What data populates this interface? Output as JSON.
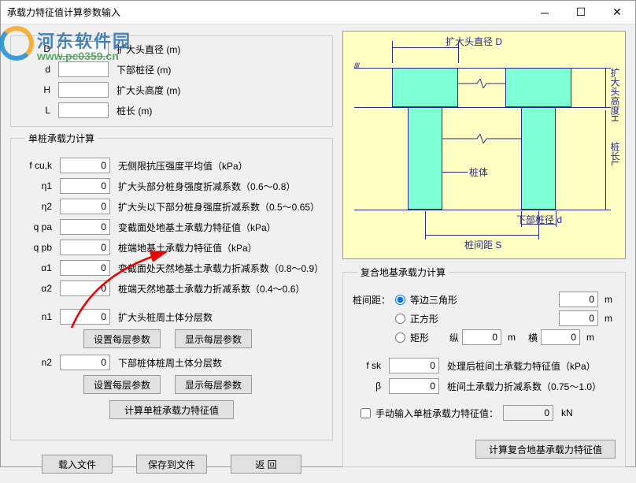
{
  "window": {
    "title": "承载力特征值计算参数输入"
  },
  "watermark": {
    "logo_text": "河东软件园",
    "url_text": "www.pc0359.cn"
  },
  "geom": {
    "D": {
      "sym": "D",
      "val": "",
      "desc": "扩大头直径  (m)"
    },
    "d": {
      "sym": "d",
      "val": "",
      "desc": "下部桩径  (m)"
    },
    "H": {
      "sym": "H",
      "val": "",
      "desc": "扩大头高度  (m)"
    },
    "L": {
      "sym": "L",
      "val": "",
      "desc": "桩长  (m)"
    }
  },
  "sec1": {
    "title": "单桩承载力计算",
    "fcu": {
      "sym": "f cu,k",
      "val": "0",
      "desc": "无侧限抗压强度平均值（kPa）"
    },
    "eta1": {
      "sym": "η1",
      "val": "0",
      "desc": "扩大头部分桩身强度折减系数（0.6～0.8）"
    },
    "eta2": {
      "sym": "η2",
      "val": "0",
      "desc": "扩大头以下部分桩身强度折减系数（0.5～0.65）"
    },
    "qpa": {
      "sym": "q pa",
      "val": "0",
      "desc": "变截面处地基土承载力特征值（kPa）"
    },
    "qpb": {
      "sym": "q pb",
      "val": "0",
      "desc": "桩端地基土承载力特征值（kPa）"
    },
    "a1": {
      "sym": "α1",
      "val": "0",
      "desc": "变截面处天然地基土承载力折减系数（0.8～0.9）"
    },
    "a2": {
      "sym": "α2",
      "val": "0",
      "desc": "桩端天然地基土承载力折减系数（0.4～0.6）"
    },
    "n1": {
      "sym": "n1",
      "val": "0",
      "desc": "扩大头桩周土体分层数"
    },
    "setLayer_btn": "设置每层参数",
    "showLayer_btn": "显示每层参数",
    "n2": {
      "sym": "n2",
      "val": "0",
      "desc": "下部桩体桩周土体分层数"
    },
    "calc_btn": "计算单桩承载力特征值"
  },
  "bottom": {
    "load_btn": "载入文件",
    "save_btn": "保存到文件",
    "return_btn": "返  回"
  },
  "sec2": {
    "title": "复合地基承载力计算",
    "spacing_label": "桩间距：",
    "opt_tri": "等边三角形",
    "tri_val": "0",
    "tri_unit": "m",
    "opt_sq": "正方形",
    "sq_val": "0",
    "sq_unit": "m",
    "opt_rect": "矩形",
    "rect_v_label": "纵",
    "rect_v_val": "0",
    "rect_v_unit": "m",
    "rect_h_label": "横",
    "rect_h_val": "0",
    "rect_h_unit": "m",
    "fsk": {
      "sym": "f sk",
      "val": "0",
      "desc": "处理后桩间土承载力特征值（kPa）"
    },
    "beta": {
      "sym": "β",
      "val": "0",
      "desc": "桩间土承载力折减系数（0.75～1.0）"
    },
    "manual_label": "手动输入单桩承载力特征值：",
    "manual_val": "0",
    "manual_unit": "kN",
    "calc_btn": "计算复合地基承载力特征值"
  },
  "diagram": {
    "top_label": "扩大头直径 D",
    "right_label1": "扩大头高度H",
    "right_label2": "桩长L",
    "body_label": "桩体",
    "d_label": "下部桩径 d",
    "s_label": "桩间距 S"
  }
}
